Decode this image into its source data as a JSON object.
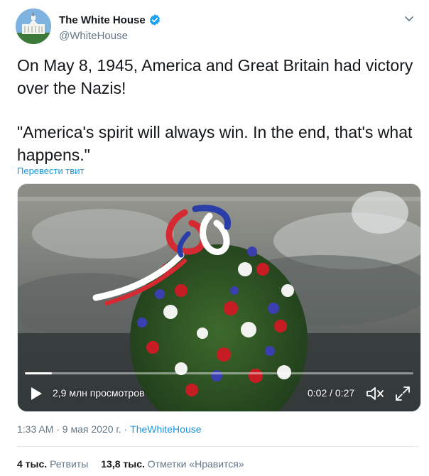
{
  "account": {
    "name": "The White House",
    "handle": "@WhiteHouse"
  },
  "tweet": {
    "paragraph1": "On May 8, 1945, America and Great Britain had victory over the Nazis!",
    "paragraph2": "\"America's spirit will always win. In the end, that's what happens.\"",
    "translate_label": "Перевести твит"
  },
  "video": {
    "views": "2,9 млн просмотров",
    "time": "0:02 / 0:27",
    "progress_fraction": 0.07
  },
  "meta": {
    "timestamp": "1:33 AM · 9 мая 2020 г. · ",
    "source": "TheWhiteHouse"
  },
  "stats": {
    "retweets_count": "4 тыс.",
    "retweets_label": "Ретвиты",
    "likes_count": "13,8 тыс.",
    "likes_label": "Отметки «Нравится»"
  },
  "colors": {
    "verified": "#1da1f2",
    "link": "#1b95e0",
    "muted": "#657786"
  }
}
